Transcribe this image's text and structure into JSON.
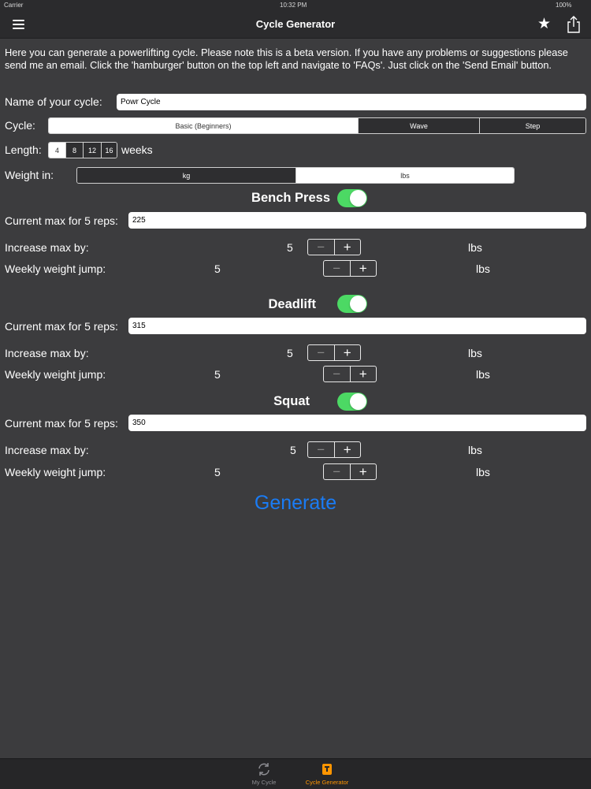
{
  "status": {
    "carrier": "Carrier",
    "time": "10:32 PM",
    "battery": "100%"
  },
  "nav": {
    "title": "Cycle Generator",
    "menu_icon": "hamburger-icon",
    "favorite_icon": "star-icon",
    "share_icon": "share-icon"
  },
  "intro": "Here you can generate a powerlifting cycle. Please note this is a beta version. If you have any problems or suggestions please send me an email. Click the 'hamburger' button on the top left and navigate to 'FAQs'. Just click on the 'Send Email' button.",
  "cycle_name": {
    "label": "Name of your cycle:",
    "value": "Powr Cycle"
  },
  "cycle": {
    "label": "Cycle:",
    "options": [
      "Basic (Beginners)",
      "Wave",
      "Step"
    ],
    "selected": "Basic (Beginners)"
  },
  "length": {
    "label": "Length:",
    "options": [
      "4",
      "8",
      "12",
      "16"
    ],
    "selected": "4",
    "unit": "weeks"
  },
  "weight": {
    "label": "Weight in:",
    "options": [
      "kg",
      "lbs"
    ],
    "selected": "lbs"
  },
  "lifts": [
    {
      "name": "Bench Press",
      "enabled": true,
      "max_label": "Current max for 5 reps:",
      "max_value": "225",
      "increase_label": "Increase max by:",
      "increase_value": "5",
      "increase_unit": "lbs",
      "jump_label": "Weekly weight jump:",
      "jump_value": "5",
      "jump_unit": "lbs"
    },
    {
      "name": "Deadlift",
      "enabled": true,
      "max_label": "Current max for 5 reps:",
      "max_value": "315",
      "increase_label": "Increase max by:",
      "increase_value": "5",
      "increase_unit": "lbs",
      "jump_label": "Weekly weight jump:",
      "jump_value": "5",
      "jump_unit": "lbs"
    },
    {
      "name": "Squat",
      "enabled": true,
      "max_label": "Current max for 5 reps:",
      "max_value": "350",
      "increase_label": "Increase max by:",
      "increase_value": "5",
      "increase_unit": "lbs",
      "jump_label": "Weekly weight jump:",
      "jump_value": "5",
      "jump_unit": "lbs"
    }
  ],
  "stepper": {
    "minus": "−",
    "plus": "+"
  },
  "generate_label": "Generate",
  "tabs": [
    {
      "label": "My Cycle",
      "icon": "refresh-icon",
      "active": false
    },
    {
      "label": "Cycle Generator",
      "icon": "dumbbell-icon",
      "active": true
    }
  ],
  "colors": {
    "background": "#3c3c3e",
    "toggle_on": "#4cd964",
    "generate": "#1a7cf5",
    "active_tab": "#ff9500"
  }
}
